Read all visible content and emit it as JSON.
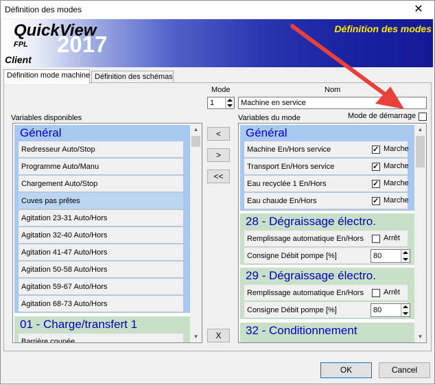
{
  "window": {
    "title": "Définition des modes",
    "close_glyph": "✕"
  },
  "banner": {
    "product": "QuickView",
    "sub": "FPL",
    "year": "2017",
    "edition": "Client",
    "heading": "Définition des modes",
    "heading_color": "#ffe800"
  },
  "tabs": [
    {
      "label": "Définition mode machine",
      "active": true
    },
    {
      "label": "Définition des schémas",
      "active": false
    }
  ],
  "form": {
    "mode_label": "Mode",
    "mode_value": "1",
    "nom_label": "Nom",
    "nom_value": "Machine en service",
    "startup_label": "Mode de démarrage",
    "startup_checked": false
  },
  "left": {
    "title": "Variables disponibles",
    "sections": [
      {
        "name": "Général",
        "items": [
          "Redresseur Auto/Stop",
          "Programme Auto/Manu",
          "Chargement Auto/Stop",
          "Cuves pas prêtes",
          "Agitation 23-31 Auto/Hors",
          "Agitation 32-40 Auto/Hors",
          "Agitation 41-47 Auto/Hors",
          "Agitation 50-58 Auto/Hors",
          "Agitation 59-67 Auto/Hors",
          "Agitation 68-73 Auto/Hors"
        ],
        "selected_index": 3
      },
      {
        "name": "01 - Charge/transfert 1",
        "items": [
          "Barrière coupée"
        ]
      }
    ]
  },
  "middle_buttons": {
    "add": "<",
    "remove": ">",
    "remove_all": "<<",
    "clear": "X"
  },
  "right": {
    "title": "Variables du mode",
    "sections": [
      {
        "name": "Général",
        "rows": [
          {
            "label": "Machine En/Hors service",
            "checked": true,
            "state": "Marche"
          },
          {
            "label": "Transport En/Hors service",
            "checked": true,
            "state": "Marche"
          },
          {
            "label": "Eau recyclée 1 En/Hors",
            "checked": true,
            "state": "Marche"
          },
          {
            "label": "Eau chaude En/Hors",
            "checked": true,
            "state": "Marche"
          }
        ]
      },
      {
        "name": "28 - Dégraissage électro.",
        "rows": [
          {
            "label": "Remplissage automatique En/Hors",
            "checked": false,
            "state": "Arrêt"
          },
          {
            "label": "Consigne Débit pompe [%]",
            "value": "80"
          }
        ]
      },
      {
        "name": "29 - Dégraissage électro.",
        "rows": [
          {
            "label": "Remplissage automatique En/Hors",
            "checked": false,
            "state": "Arrêt"
          },
          {
            "label": "Consigne Débit pompe [%]",
            "value": "80"
          }
        ]
      },
      {
        "name": "32 - Conditionnement",
        "rows": []
      }
    ]
  },
  "footer": {
    "ok_label": "OK",
    "cancel_label": "Cancel"
  },
  "colors": {
    "general_bg": "#a8c8f0",
    "section_bg": "#c8e0c8",
    "section_title": "#0000cc",
    "annotation_arrow": "#e8413c"
  }
}
